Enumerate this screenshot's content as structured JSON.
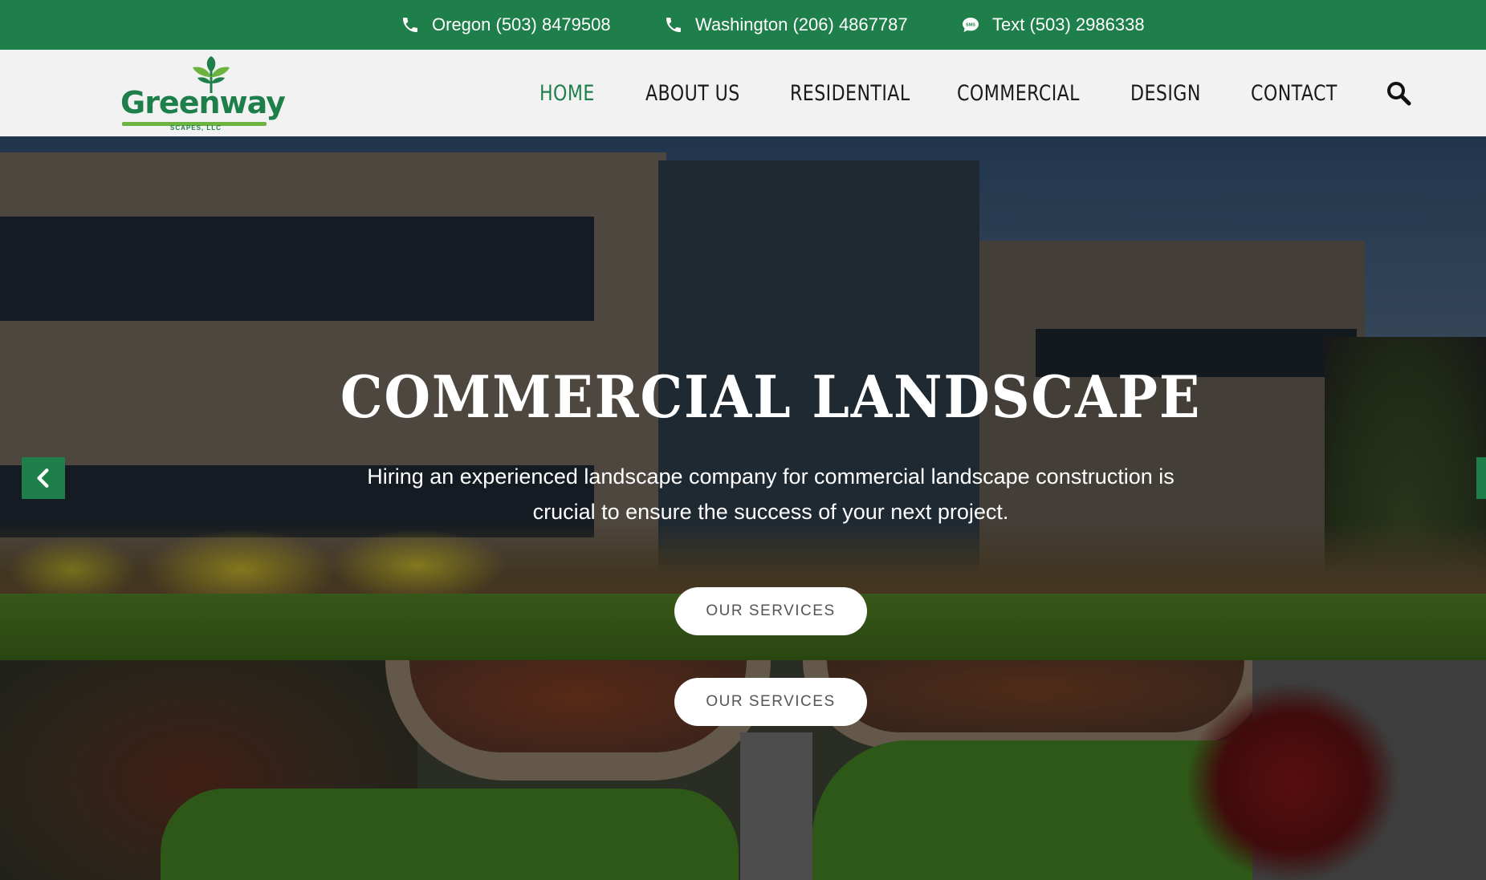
{
  "topbar": {
    "oregon": "Oregon (503) 8479508",
    "washington": "Washington (206) 4867787",
    "text": "Text (503) 2986338"
  },
  "logo": {
    "name": "Greenway",
    "sub": "SCAPES, LLC"
  },
  "nav": {
    "items": [
      "HOME",
      "ABOUT US",
      "RESIDENTIAL",
      "COMMERCIAL",
      "DESIGN",
      "CONTACT"
    ],
    "active": "HOME"
  },
  "hero": {
    "title": "COMMERCIAL LANDSCAPE",
    "text": "Hiring an experienced landscape company for commercial landscape construction is crucial to ensure the success of your next project.",
    "button": "OUR SERVICES"
  },
  "design": {
    "button": "OUR SERVICES"
  },
  "colors": {
    "brand_green": "#1f7f4a",
    "nav_bg": "#f2f2f2",
    "logo_leaf": "#6cb33f"
  },
  "icons": [
    "phone-icon",
    "phone-icon",
    "sms-icon",
    "search-icon",
    "chevron-left-icon"
  ]
}
